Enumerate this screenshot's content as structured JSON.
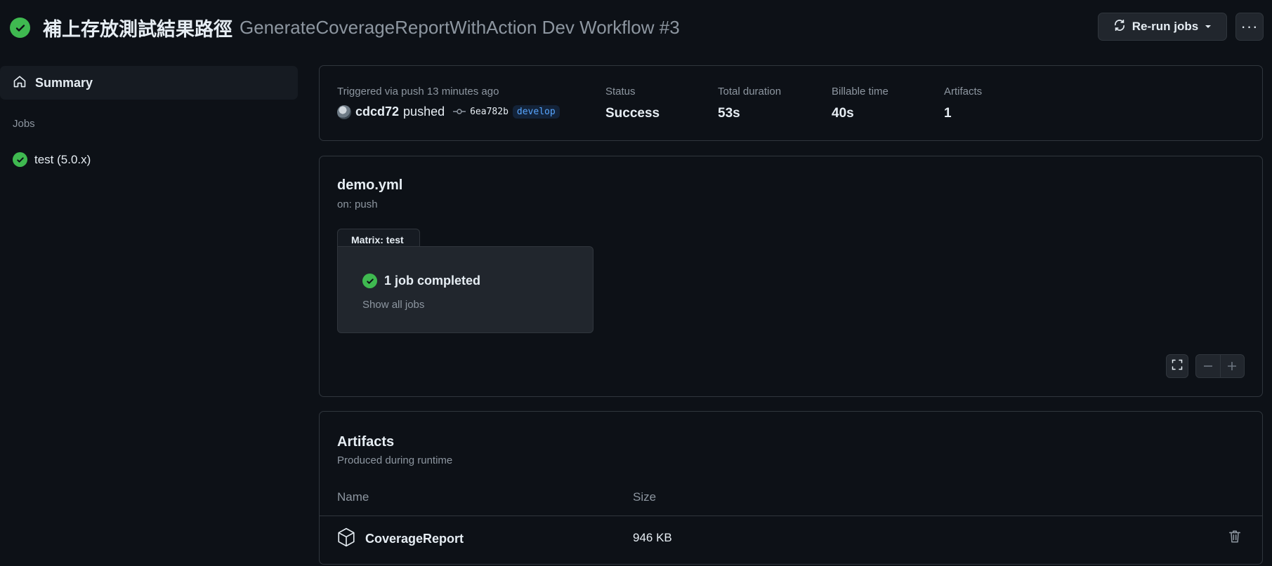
{
  "header": {
    "commit_title": "補上存放測試結果路徑",
    "workflow_title": "GenerateCoverageReportWithAction Dev Workflow #3",
    "rerun_label": "Re-run jobs",
    "more_label": "···",
    "status_color": "#3fb950"
  },
  "sidebar": {
    "summary_label": "Summary",
    "jobs_heading": "Jobs",
    "jobs": [
      {
        "label": "test (5.0.x)",
        "status": "success"
      }
    ]
  },
  "run_info": {
    "trigger_text": "Triggered via push 13 minutes ago",
    "user": "cdcd72",
    "action": "pushed",
    "commit_sha": "6ea782b",
    "branch": "develop",
    "status_label": "Status",
    "status_value": "Success",
    "duration_label": "Total duration",
    "duration_value": "53s",
    "billable_label": "Billable time",
    "billable_value": "40s",
    "artifacts_label": "Artifacts",
    "artifacts_value": "1"
  },
  "workflow_graph": {
    "file_name": "demo.yml",
    "trigger": "on: push",
    "matrix_label": "Matrix: test",
    "completed_text": "1 job completed",
    "show_all_label": "Show all jobs"
  },
  "artifacts": {
    "title": "Artifacts",
    "subtitle": "Produced during runtime",
    "columns": [
      "Name",
      "Size"
    ],
    "rows": [
      {
        "name": "CoverageReport",
        "size": "946 KB"
      }
    ]
  },
  "icons": {
    "status": "check-circle-icon",
    "rerun": "sync-icon",
    "summary": "home-icon",
    "commit": "git-commit-icon",
    "fullscreen": "fullscreen-icon",
    "zoom_out": "minus-icon",
    "zoom_in": "plus-icon",
    "artifact": "package-icon",
    "delete": "trash-icon"
  }
}
